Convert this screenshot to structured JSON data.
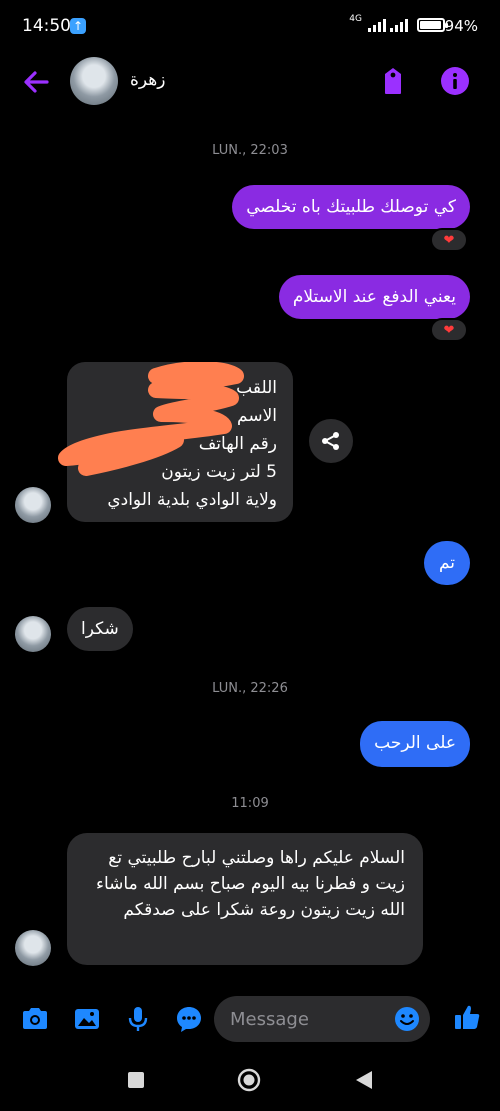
{
  "status": {
    "time": "14:50",
    "network": "4G",
    "battery": "94%"
  },
  "header": {
    "contact_name": "زهرة"
  },
  "thread": {
    "timestamp_1": "LUN., 22:03",
    "msg_1": "كي توصلك طلبيتك باه تخلصي",
    "msg_2": "يعني الدفع عند الاستلام",
    "form_lines": [
      "اللقب",
      "الاسم",
      "رقم الهاتف",
      "5 لتر زيت زيتون",
      "ولاية الوادي بلدية الوادي"
    ],
    "msg_done": "تم",
    "msg_thanks": "شكرا",
    "timestamp_2": "LUN., 22:26",
    "msg_welcome": "على الرحب",
    "timestamp_3": "11:09",
    "msg_long": "السلام عليكم راها وصلتني لبارح طلبيتي تع زيت و فطرنا بيه اليوم صباح بسم الله ماشاء الله زيت زيتون روعة شكرا على صدقكم",
    "reaction": "❤"
  },
  "composer": {
    "placeholder": "Message"
  },
  "colors": {
    "accent_purple": "#8a2be2",
    "accent_blue": "#2f6df6",
    "icon_blue": "#1e88ff",
    "incoming": "#2c2c2e"
  },
  "icons": [
    "back-arrow-icon",
    "tag-icon",
    "info-icon",
    "share-icon",
    "camera-icon",
    "image-icon",
    "mic-icon",
    "chat-dots-icon",
    "emoji-icon",
    "thumbs-up-icon",
    "square-nav-icon",
    "circle-nav-icon",
    "triangle-nav-icon"
  ]
}
